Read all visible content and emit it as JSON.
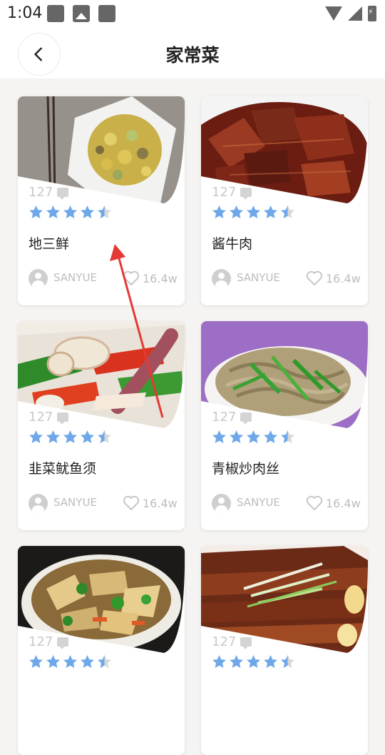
{
  "status": {
    "time": "1:04"
  },
  "header": {
    "title": "家常菜"
  },
  "colors": {
    "star": "#6fa8e8",
    "star_empty": "#d8d8d8",
    "annotation_arrow": "#e53935"
  },
  "recipes": [
    {
      "name": "地三鲜",
      "count": "127",
      "rating": 4.5,
      "author": "SANYUE",
      "likes": "16.4w"
    },
    {
      "name": "酱牛肉",
      "count": "127",
      "rating": 4.5,
      "author": "SANYUE",
      "likes": "16.4w"
    },
    {
      "name": "韭菜鱿鱼须",
      "count": "127",
      "rating": 4.5,
      "author": "SANYUE",
      "likes": "16.4w"
    },
    {
      "name": "青椒炒肉丝",
      "count": "127",
      "rating": 4.5,
      "author": "SANYUE",
      "likes": "16.4w"
    },
    {
      "name": "",
      "count": "127",
      "rating": 4.5,
      "author": "",
      "likes": ""
    },
    {
      "name": "",
      "count": "127",
      "rating": 4.5,
      "author": "",
      "likes": ""
    }
  ]
}
